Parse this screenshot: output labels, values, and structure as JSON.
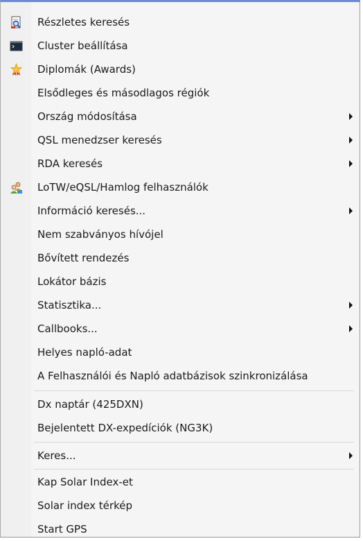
{
  "menu": {
    "items": [
      {
        "label": "Részletes keresés",
        "icon": "search-document-icon"
      },
      {
        "label": "Cluster beállítása",
        "icon": "terminal-icon"
      },
      {
        "label": "Diplomák (Awards)",
        "icon": "award-star-icon"
      },
      {
        "label": "Elsődleges és másodlagos régiók"
      },
      {
        "label": "Ország módosítása",
        "submenu": true
      },
      {
        "label": "QSL menedzser keresés",
        "submenu": true
      },
      {
        "label": "RDA keresés",
        "submenu": true
      },
      {
        "label": "LoTW/eQSL/Hamlog felhasználók",
        "icon": "users-icon"
      },
      {
        "label": "Információ keresés...",
        "submenu": true
      },
      {
        "label": "Nem szabványos hívójel"
      },
      {
        "label": "Bővített rendezés"
      },
      {
        "label": "Lokátor bázis"
      },
      {
        "label": "Statisztika...",
        "submenu": true
      },
      {
        "label": "Callbooks...",
        "submenu": true
      },
      {
        "label": "Helyes napló-adat"
      },
      {
        "label": "A Felhasználói és Napló adatbázisok szinkronizálása"
      },
      {
        "label": "Dx naptár (425DXN)"
      },
      {
        "label": "Bejelentett DX-expedíciók (NG3K)"
      },
      {
        "label": "Keres...",
        "submenu": true
      },
      {
        "label": "Kap Solar Index-et"
      },
      {
        "label": "Solar index térkép"
      },
      {
        "label": "Start GPS"
      }
    ],
    "colors": {
      "top_border": "#6f8bd0",
      "background": "#f5f5f5",
      "text": "#1a1a1a"
    }
  }
}
